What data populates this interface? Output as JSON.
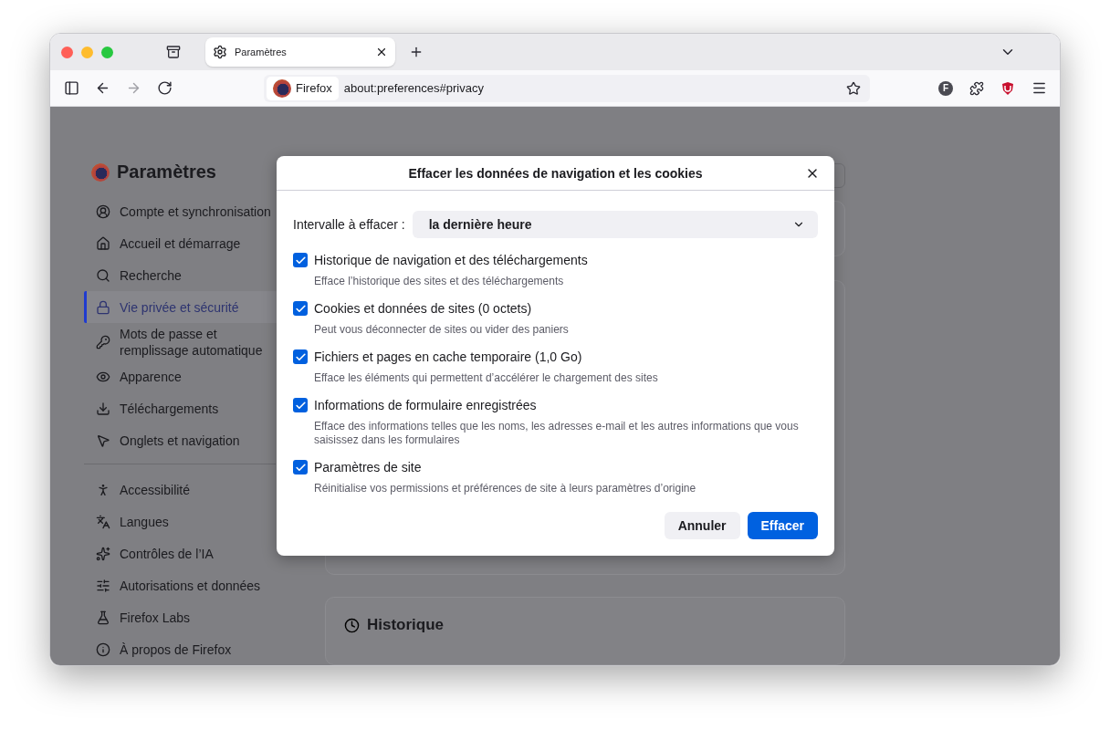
{
  "tabs": [
    {
      "title": "Paramètres",
      "selected": true
    }
  ],
  "toolbar": {
    "nav": [
      {
        "kind": "sidebar",
        "disabled": false
      },
      {
        "kind": "back",
        "disabled": false
      },
      {
        "kind": "forward",
        "disabled": true
      },
      {
        "kind": "reload",
        "disabled": false
      }
    ],
    "identity": "Firefox",
    "url": "about:preferences#privacy",
    "avatar": "F"
  },
  "sidebar": {
    "title": "Paramètres",
    "groups": [
      [
        {
          "label": "Compte et synchronisation",
          "selected": false
        },
        {
          "label": "Accueil et démarrage",
          "selected": false
        },
        {
          "label": "Recherche",
          "selected": false
        },
        {
          "label": "Vie privée et sécurité",
          "selected": true
        },
        {
          "label": "Mots de passe et remplissage automatique",
          "selected": false
        },
        {
          "label": "Apparence",
          "selected": false
        },
        {
          "label": "Téléchargements",
          "selected": false
        },
        {
          "label": "Onglets et navigation",
          "selected": false
        }
      ],
      [
        {
          "label": "Accessibilité",
          "selected": false
        },
        {
          "label": "Langues",
          "selected": false
        },
        {
          "label": "Contrôles de l’IA",
          "selected": false
        },
        {
          "label": "Autorisations et données",
          "selected": false
        },
        {
          "label": "Firefox Labs",
          "selected": false
        },
        {
          "label": "À propos de Firefox",
          "selected": false
        }
      ]
    ]
  },
  "main": {
    "section": "Historique"
  },
  "dialog": {
    "title": "Effacer les données de navigation et les cookies",
    "range_label": "Intervalle à effacer :",
    "range_value": "la dernière heure",
    "options": [
      {
        "label": "Historique de navigation et des téléchargements",
        "description": "Efface l’historique des sites et des téléchargements",
        "checked": true
      },
      {
        "label": "Cookies et données de sites (0 octets)",
        "description": "Peut vous déconnecter de sites ou vider des paniers",
        "checked": true
      },
      {
        "label": "Fichiers et pages en cache temporaire (1,0 Go)",
        "description": "Efface les éléments qui permettent d’accélérer le chargement des sites",
        "checked": true
      },
      {
        "label": "Informations de formulaire enregistrées",
        "description": "Efface des informations telles que les noms, les adresses e-mail et les autres informations que vous saisissez dans les formulaires",
        "checked": true
      },
      {
        "label": "Paramètres de site",
        "description": "Réinitialise vos permissions et préférences de site à leurs paramètres d’origine",
        "checked": true
      }
    ],
    "buttons": [
      {
        "label": "Annuler",
        "kind": "secondary"
      },
      {
        "label": "Effacer",
        "kind": "primary"
      }
    ]
  }
}
